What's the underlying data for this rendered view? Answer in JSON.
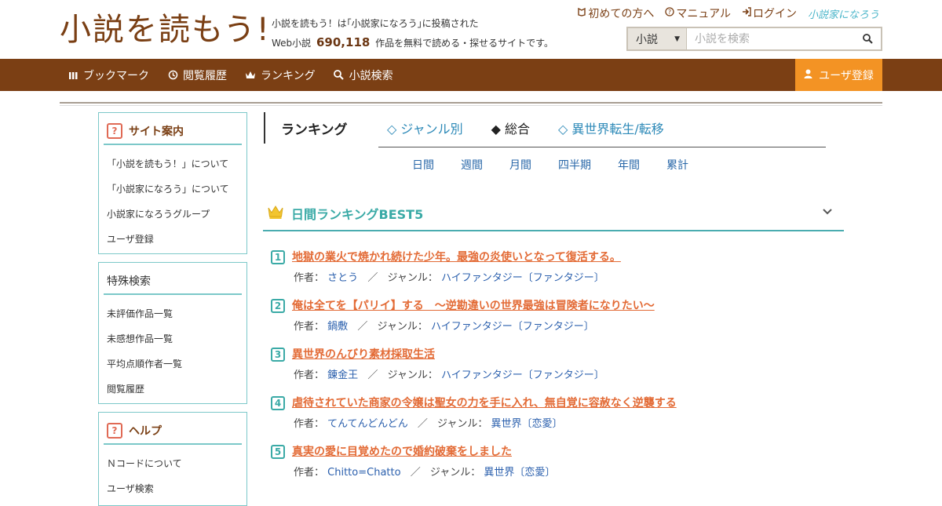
{
  "header": {
    "logo_text": "小説を読もう!",
    "desc_line1": "小説を読もう！は｢小説家になろう｣に投稿された",
    "desc_prefix": "Web小説",
    "work_count": "690,118",
    "desc_suffix": "作品を無料で読める・探せるサイトです。",
    "top_links": [
      {
        "label": "初めての方へ",
        "icon": "book-icon"
      },
      {
        "label": "マニュアル",
        "icon": "question-circle-icon"
      },
      {
        "label": "ログイン",
        "icon": "login-icon"
      }
    ],
    "narou_logo": "小説家になろう",
    "search": {
      "category": "小説",
      "placeholder": "小説を検索"
    }
  },
  "nav": {
    "items": [
      {
        "label": "ブックマーク",
        "icon": "bookmark-icon"
      },
      {
        "label": "閲覧履歴",
        "icon": "history-icon"
      },
      {
        "label": "ランキング",
        "icon": "crown-icon"
      },
      {
        "label": "小説検索",
        "icon": "search-icon"
      }
    ],
    "register": "ユーザ登録"
  },
  "sidebar": {
    "site_guide": {
      "title": "サイト案内",
      "items": [
        "「小説を読もう！」について",
        "「小説家になろう」について",
        "小説家になろうグループ",
        "ユーザ登録"
      ]
    },
    "special_search": {
      "title": "特殊検索",
      "items": [
        "未評価作品一覧",
        "未感想作品一覧",
        "平均点順作者一覧",
        "閲覧履歴"
      ]
    },
    "help": {
      "title": "ヘルプ",
      "items": [
        "Ｎコードについて",
        "ユーザ検索"
      ]
    }
  },
  "ranking": {
    "title": "ランキング",
    "tabs": [
      {
        "label": "◇ ジャンル別",
        "active": false
      },
      {
        "label": "◆ 総合",
        "active": true
      },
      {
        "label": "◇ 異世界転生/転移",
        "active": false
      }
    ],
    "periods": [
      "日間",
      "週間",
      "月間",
      "四半期",
      "年間",
      "累計"
    ],
    "best_title": "日間ランキングBEST5",
    "author_label": "作者：",
    "genre_label": "ジャンル：",
    "items": [
      {
        "rank": "1",
        "title": "地獄の業火で焼かれ続けた少年。最強の炎使いとなって復活する。",
        "author": "さとう",
        "genre": "ハイファンタジー〔ファンタジー〕"
      },
      {
        "rank": "2",
        "title": "俺は全てを【パリイ】する　～逆勘違いの世界最強は冒険者になりたい～",
        "author": "鍋敷",
        "genre": "ハイファンタジー〔ファンタジー〕"
      },
      {
        "rank": "3",
        "title": "異世界のんびり素材採取生活",
        "author": "錬金王",
        "genre": "ハイファンタジー〔ファンタジー〕"
      },
      {
        "rank": "4",
        "title": "虐待されていた商家の令嬢は聖女の力を手に入れ、無自覚に容赦なく逆襲する",
        "author": "てんてんどんどん",
        "genre": "異世界〔恋愛〕"
      },
      {
        "rank": "5",
        "title": "真実の愛に目覚めたので婚約破棄をしました",
        "author": "Chitto=Chatto",
        "genre": "異世界〔恋愛〕"
      }
    ]
  },
  "colors": {
    "brand_brown": "#7b3f14",
    "accent_orange": "#f39324",
    "teal": "#3aaaa6",
    "title_orange": "#e36b36",
    "link_blue": "#2a5fad"
  }
}
